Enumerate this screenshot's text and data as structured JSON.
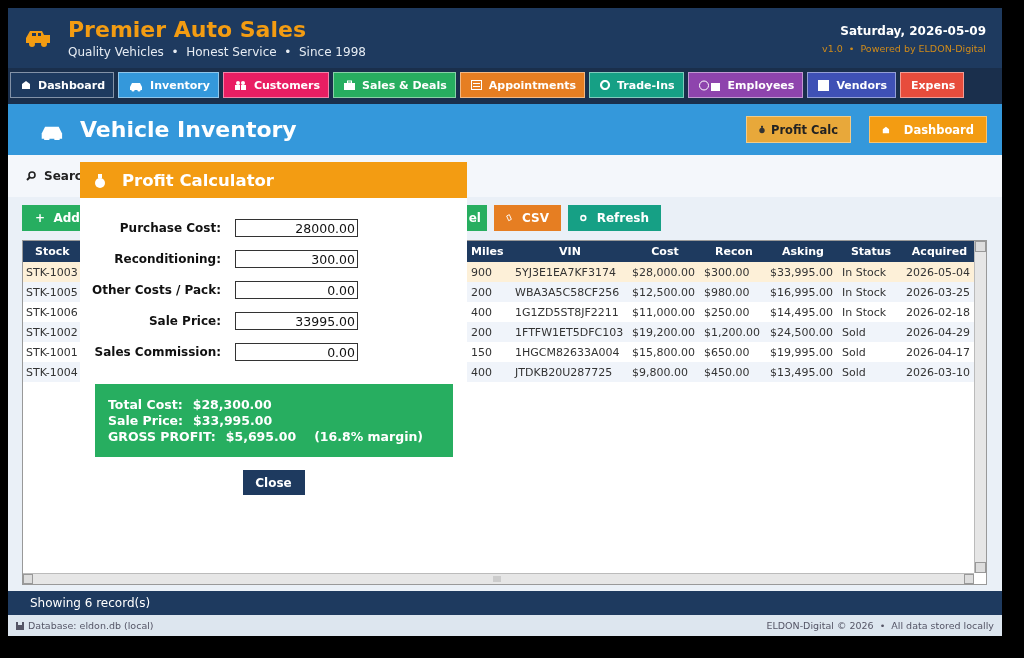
{
  "header": {
    "title": "Premier Auto Sales",
    "subtitle": "Quality Vehicles  •  Honest Service  •  Since 1998",
    "date": "Saturday, 2026-05-09",
    "version": "v1.0  •  Powered by ELDON-Digital"
  },
  "nav_tabs": [
    {
      "label": "Dashboard",
      "color": "#1e3a5f"
    },
    {
      "label": "Inventory",
      "color": "#3498db"
    },
    {
      "label": "Customers",
      "color": "#e91e63"
    },
    {
      "label": "Sales & Deals",
      "color": "#27ae60"
    },
    {
      "label": "Appointments",
      "color": "#e67e22"
    },
    {
      "label": "Trade-Ins",
      "color": "#16a085"
    },
    {
      "label": "Employees",
      "color": "#8e44ad"
    },
    {
      "label": "Vendors",
      "color": "#3f51b5"
    },
    {
      "label": "Expens",
      "color": "#e74c3c"
    }
  ],
  "page": {
    "title": "Vehicle Inventory",
    "buttons": [
      {
        "label": "Profit Calc",
        "kind": "light"
      },
      {
        "label": "Dashboard",
        "kind": "primary"
      }
    ]
  },
  "search": {
    "label": "Searc"
  },
  "toolbar": [
    {
      "label": "+  Add",
      "color": "#27ae60"
    },
    {
      "label": "el",
      "color": "#27ae60"
    },
    {
      "label": "CSV",
      "color": "#e67e22"
    },
    {
      "label": "Refresh",
      "color": "#16a085"
    }
  ],
  "table": {
    "columns": [
      "Stock",
      "",
      "Miles",
      "VIN",
      "Cost",
      "Recon",
      "Asking",
      "Status",
      "Acquired"
    ],
    "rows": [
      {
        "selected": true,
        "cells": [
          "STK-1003",
          "",
          "900",
          "5YJ3E1EA7KF3174",
          "$28,000.00",
          "$300.00",
          "$33,995.00",
          "In Stock",
          "2026-05-04"
        ]
      },
      {
        "selected": false,
        "cells": [
          "STK-1005",
          "",
          "200",
          "WBA3A5C58CF256",
          "$12,500.00",
          "$980.00",
          "$16,995.00",
          "In Stock",
          "2026-03-25"
        ]
      },
      {
        "selected": false,
        "cells": [
          "STK-1006",
          "",
          "400",
          "1G1ZD5ST8JF2211",
          "$11,000.00",
          "$250.00",
          "$14,495.00",
          "In Stock",
          "2026-02-18"
        ]
      },
      {
        "selected": false,
        "cells": [
          "STK-1002",
          "",
          "200",
          "1FTFW1ET5DFC103",
          "$19,200.00",
          "$1,200.00",
          "$24,500.00",
          "Sold",
          "2026-04-29"
        ]
      },
      {
        "selected": false,
        "cells": [
          "STK-1001",
          "",
          "150",
          "1HGCM82633A004",
          "$15,800.00",
          "$650.00",
          "$19,995.00",
          "Sold",
          "2026-04-17"
        ]
      },
      {
        "selected": false,
        "cells": [
          "STK-1004",
          "",
          "400",
          "JTDKB20U287725",
          "$9,800.00",
          "$450.00",
          "$13,495.00",
          "Sold",
          "2026-03-10"
        ]
      }
    ]
  },
  "status_bar": "Showing 6 record(s)",
  "footer": {
    "left": "Database: eldon.db (local)",
    "right": "ELDON-Digital © 2026  •  All data stored locally"
  },
  "dialog": {
    "title": "Profit Calculator",
    "fields": [
      {
        "label": "Purchase Cost:",
        "value": "28000.00"
      },
      {
        "label": "Reconditioning:",
        "value": "300.00"
      },
      {
        "label": "Other Costs / Pack:",
        "value": "0.00"
      },
      {
        "label": "Sale Price:",
        "value": "33995.00"
      },
      {
        "label": "Sales Commission:",
        "value": "0.00"
      }
    ],
    "result": [
      {
        "label": "Total Cost:",
        "value": "$28,300.00"
      },
      {
        "label": "Sale Price:",
        "value": "$33,995.00"
      },
      {
        "label": "GROSS PROFIT:",
        "value": "$5,695.00",
        "note": "(16.8% margin)"
      }
    ],
    "button": "Close"
  }
}
